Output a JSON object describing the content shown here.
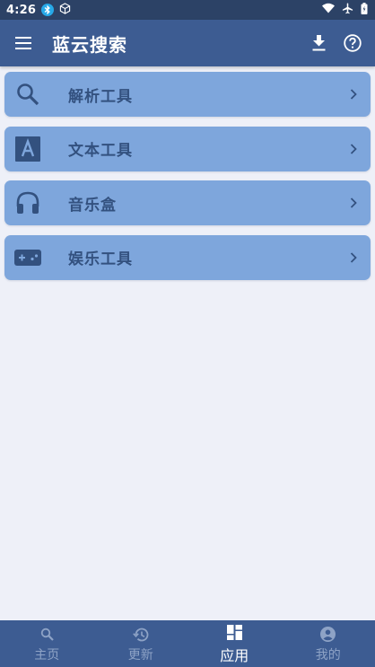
{
  "status_bar": {
    "time": "4:26"
  },
  "app_bar": {
    "title": "蓝云搜索",
    "icons": [
      "menu-icon",
      "download-icon",
      "help-icon"
    ]
  },
  "tools": [
    {
      "label": "解析工具",
      "icon": "search-icon"
    },
    {
      "label": "文本工具",
      "icon": "text-icon"
    },
    {
      "label": "音乐盒",
      "icon": "headphones-icon"
    },
    {
      "label": "娱乐工具",
      "icon": "gamepad-icon"
    }
  ],
  "bottom_nav": {
    "items": [
      {
        "label": "主页",
        "icon": "search-icon",
        "active": false
      },
      {
        "label": "更新",
        "icon": "history-icon",
        "active": false
      },
      {
        "label": "应用",
        "icon": "dashboard-icon",
        "active": true
      },
      {
        "label": "我的",
        "icon": "account-icon",
        "active": false
      }
    ]
  },
  "colors": {
    "status_bar": "#2c4266",
    "app_bar": "#3d5c92",
    "card": "#7ea6dc",
    "card_text": "#33517f",
    "background": "#eef0f8",
    "nav_inactive": "#8ea3c6",
    "nav_active": "#ffffff"
  }
}
